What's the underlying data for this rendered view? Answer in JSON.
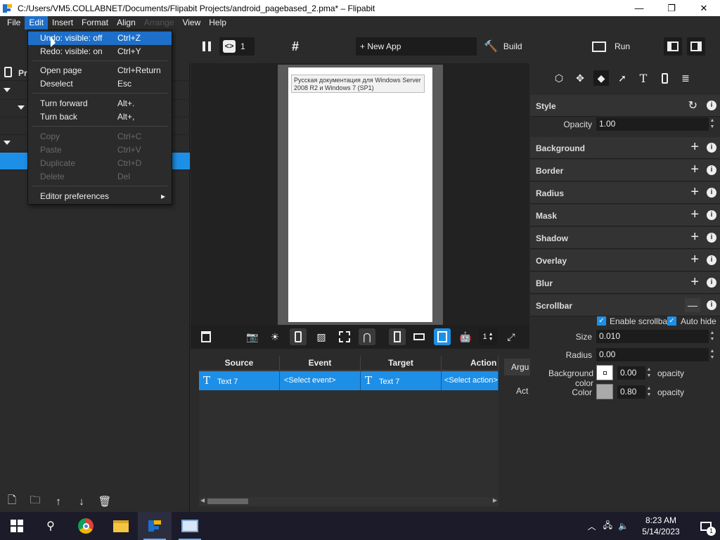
{
  "window": {
    "title": "C:/Users/VM5.COLLABNET/Documents/Flipabit Projects/android_pagebased_2.pma* – Flipabit",
    "minimize": "—",
    "maximize": "❐",
    "close": "✕",
    "icon": "flipabit-app-icon"
  },
  "menu": {
    "items": [
      "File",
      "Edit",
      "Insert",
      "Format",
      "Align",
      "Arrange",
      "View",
      "Help"
    ],
    "active": "Edit"
  },
  "edit_menu": {
    "undo": {
      "label": "Undo:  visible: off",
      "shortcut": "Ctrl+Z"
    },
    "redo": {
      "label": "Redo:  visible: on",
      "shortcut": "Ctrl+Y"
    },
    "open_page": {
      "label": "Open page",
      "shortcut": "Ctrl+Return"
    },
    "deselect": {
      "label": "Deselect",
      "shortcut": "Esc"
    },
    "turn_forward": {
      "label": "Turn forward",
      "shortcut": "Alt+."
    },
    "turn_back": {
      "label": "Turn back",
      "shortcut": "Alt+,"
    },
    "copy": {
      "label": "Copy",
      "shortcut": "Ctrl+C"
    },
    "paste": {
      "label": "Paste",
      "shortcut": "Ctrl+V"
    },
    "duplicate": {
      "label": "Duplicate",
      "shortcut": "Ctrl+D"
    },
    "delete": {
      "label": "Delete",
      "shortcut": "Del"
    },
    "editor_preferences": {
      "label": "Editor preferences",
      "arrow": "▸"
    }
  },
  "toolbar": {
    "page_number": "1",
    "new_app": "+ New App",
    "build": "Build",
    "run": "Run"
  },
  "left_panel": {
    "header_label": "Pr"
  },
  "canvas": {
    "text_line1": "Русская документация для Windows Server",
    "text_line2": "2008 R2 и Windows 7 (SP1)",
    "zoom_value": "1"
  },
  "events_table": {
    "headers": [
      "Source",
      "Event",
      "Target",
      "Action"
    ],
    "row": {
      "source": "Text 7",
      "event": "<Select event>",
      "target": "Text 7",
      "action": "<Select action>"
    },
    "args_button": "Argu",
    "action_label": "Act"
  },
  "properties": {
    "style": {
      "title": "Style",
      "opacity_label": "Opacity",
      "opacity_value": "1.00"
    },
    "sections": [
      "Background",
      "Border",
      "Radius",
      "Mask",
      "Shadow",
      "Overlay",
      "Blur"
    ],
    "scrollbar": {
      "title": "Scrollbar",
      "enable_label": "Enable scrollbar",
      "autohide_label": "Auto hide",
      "size_label": "Size",
      "size_value": "0.010",
      "radius_label": "Radius",
      "radius_value": "0.00",
      "bg_color_label": "Background color",
      "bg_opacity_value": "0.00",
      "opacity_label": "opacity",
      "color_label": "Color",
      "color_opacity_value": "0.80",
      "bg_swatch_color": "#ffffff",
      "color_swatch_color": "#aaaaaa"
    }
  },
  "taskbar": {
    "time": "8:23 AM",
    "date": "5/14/2023",
    "notification_count": "1"
  },
  "colors": {
    "accent": "#1e8fe6",
    "menu_highlight": "#1e6fc9",
    "panel_bg": "#2b2b2b"
  }
}
